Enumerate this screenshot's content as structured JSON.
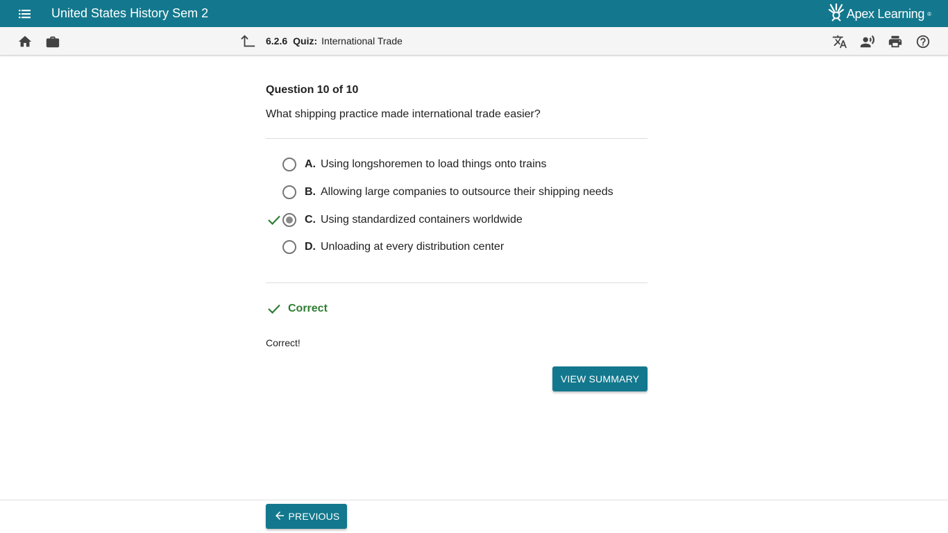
{
  "appbar": {
    "title": "United States History Sem 2",
    "brand": "Apex Learning",
    "brand_mark": "®",
    "icons": {
      "menu": "menu-icon",
      "brand_logo": "apex-sun-logo-icon"
    }
  },
  "toolbar": {
    "icons": [
      "home-icon",
      "briefcase-icon",
      "up-arrow-icon",
      "translate-icon",
      "text-to-speech-icon",
      "print-icon",
      "help-icon"
    ],
    "breadcrumb": {
      "code": "6.2.6",
      "kind": "Quiz:",
      "title": "International Trade"
    }
  },
  "question": {
    "number_label": "Question 10 of 10",
    "text": "What shipping practice made international trade easier?",
    "options": [
      {
        "letter": "A.",
        "text": "Using longshoremen to load things onto trains",
        "selected": false,
        "correct": false
      },
      {
        "letter": "B.",
        "text": "Allowing large companies to outsource their shipping needs",
        "selected": false,
        "correct": false
      },
      {
        "letter": "C.",
        "text": "Using standardized containers worldwide",
        "selected": true,
        "correct": true
      },
      {
        "letter": "D.",
        "text": "Unloading at every distribution center",
        "selected": false,
        "correct": false
      }
    ]
  },
  "result": {
    "label": "Correct",
    "feedback": "Correct!"
  },
  "buttons": {
    "view_summary": "VIEW SUMMARY",
    "previous": "PREVIOUS"
  },
  "colors": {
    "primary": "#13788d",
    "correct_green": "#2e7d32",
    "toolbar_bg": "#f5f5f5"
  }
}
